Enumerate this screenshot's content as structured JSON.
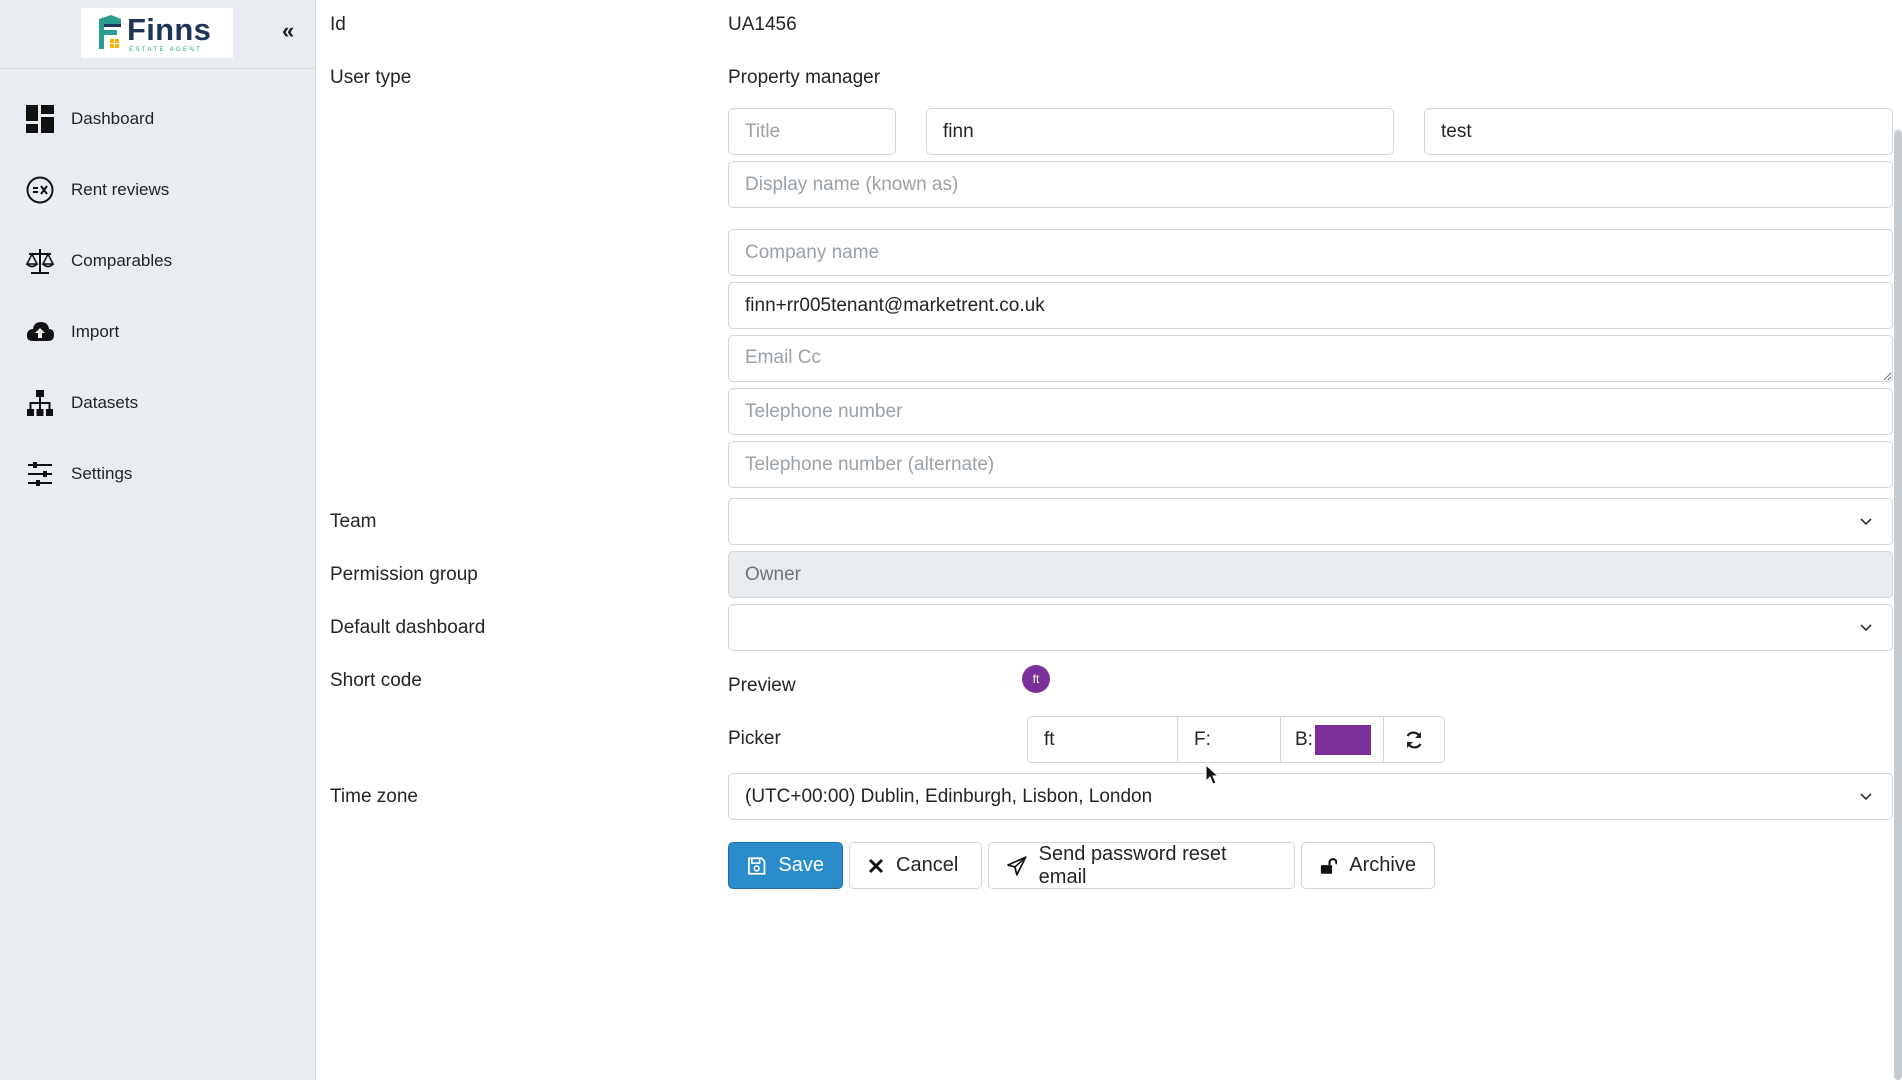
{
  "sidebar": {
    "logo_name": "Finns",
    "logo_tagline": "ESTATE AGENT",
    "collapse_glyph": "«",
    "items": [
      {
        "label": "Dashboard",
        "icon": "dashboard-icon"
      },
      {
        "label": "Rent reviews",
        "icon": "rent-reviews-icon"
      },
      {
        "label": "Comparables",
        "icon": "scales-icon"
      },
      {
        "label": "Import",
        "icon": "cloud-upload-icon"
      },
      {
        "label": "Datasets",
        "icon": "sitemap-icon"
      },
      {
        "label": "Settings",
        "icon": "sliders-icon"
      }
    ]
  },
  "form": {
    "id_label": "Id",
    "id_value": "UA1456",
    "user_type_label": "User type",
    "user_type_value": "Property manager",
    "title_placeholder": "Title",
    "first_name": "finn",
    "last_name": "test",
    "display_name_placeholder": "Display name (known as)",
    "company_placeholder": "Company name",
    "email": "finn+rr005tenant@marketrent.co.uk",
    "email_cc_placeholder": "Email Cc",
    "telephone_placeholder": "Telephone number",
    "telephone_alt_placeholder": "Telephone number (alternate)",
    "team_label": "Team",
    "team_value": "",
    "permission_label": "Permission group",
    "permission_value": "Owner",
    "dashboard_label": "Default dashboard",
    "dashboard_value": "",
    "short_code_label": "Short code",
    "preview_label": "Preview",
    "preview_avatar_text": "ft",
    "picker_label": "Picker",
    "picker_text": "ft",
    "picker_f_label": "F:",
    "picker_b_label": "B:",
    "timezone_label": "Time zone",
    "timezone_value": "(UTC+00:00) Dublin, Edinburgh, Lisbon, London"
  },
  "buttons": {
    "save": "Save",
    "cancel": "Cancel",
    "reset": "Send password reset email",
    "archive": "Archive"
  },
  "colors": {
    "foreground": "#ffffff",
    "background": "#7a2f9a",
    "primary": "#2b8ccc"
  }
}
